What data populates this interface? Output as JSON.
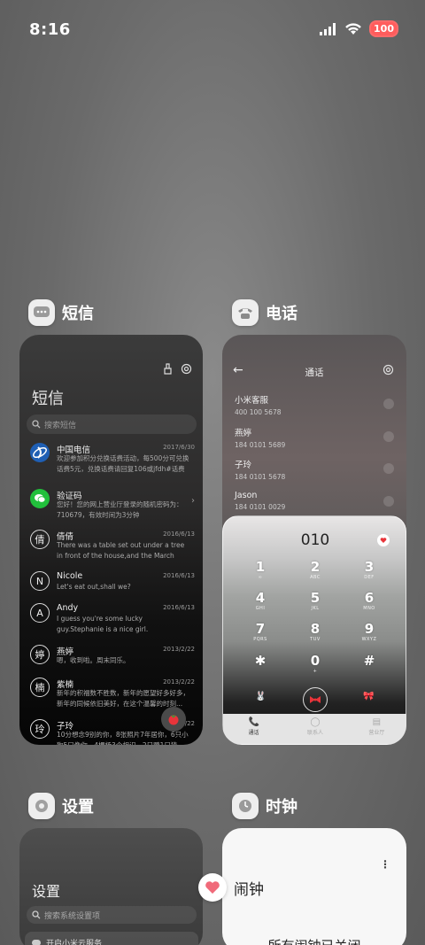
{
  "status_bar": {
    "time": "8:16",
    "battery": "100"
  },
  "apps": {
    "sms": {
      "name": "短信",
      "title": "短信",
      "search_placeholder": "搜索短信",
      "messages": [
        {
          "avatar": "",
          "name": "中国电信",
          "date": "2017/6/30",
          "text": "欢迎参加积分兑换话费活动，每500分可兑换话费5元，兑换话费请回复106或jfdh#话费"
        },
        {
          "avatar": "",
          "name": "验证码",
          "date": "",
          "text": "您好！您的网上营业厅登录的随机密码为：710679，有效时间为3分钟"
        },
        {
          "avatar": "倩",
          "name": "倩倩",
          "date": "2016/6/13",
          "text": "There was a table set out under a tree in front of the house,and the March Hare an..."
        },
        {
          "avatar": "N",
          "name": "Nicole",
          "date": "2016/6/13",
          "text": "Let's eat out,shall we?"
        },
        {
          "avatar": "A",
          "name": "Andy",
          "date": "2016/6/13",
          "text": "I guess you're some lucky guy.Stephanie is a nice girl."
        },
        {
          "avatar": "婷",
          "name": "燕婷",
          "date": "2013/2/22",
          "text": "嗯，收到啦。周末同乐。"
        },
        {
          "avatar": "楠",
          "name": "紫楠",
          "date": "2013/2/22",
          "text": "新年的积福数不胜数，新年的愿望好多好多，新年的同候依旧美好，在这个温馨的时刻..."
        },
        {
          "avatar": "玲",
          "name": "子玲",
          "date": "2013/2/22",
          "text": "10分想念9别的你，8张照片7年居你，6只小狗5只像你，4棵杨3个相识，2只鹦1只猜"
        }
      ]
    },
    "phone": {
      "name": "电话",
      "title": "通话",
      "calls": [
        {
          "name": "小米客服",
          "number": "400 100 5678"
        },
        {
          "name": "燕婷",
          "number": "184 0101 5689"
        },
        {
          "name": "子玲",
          "number": "184 0101 5678"
        },
        {
          "name": "Jason",
          "number": "184 0101 0029"
        }
      ],
      "dial_number": "010",
      "keys": [
        {
          "d": "1",
          "l": "∞"
        },
        {
          "d": "2",
          "l": "ABC"
        },
        {
          "d": "3",
          "l": "DEF"
        },
        {
          "d": "4",
          "l": "GHI"
        },
        {
          "d": "5",
          "l": "JKL"
        },
        {
          "d": "6",
          "l": "MNO"
        },
        {
          "d": "7",
          "l": "PQRS"
        },
        {
          "d": "8",
          "l": "TUV"
        },
        {
          "d": "9",
          "l": "WXYZ"
        },
        {
          "d": "✱",
          "l": ""
        },
        {
          "d": "0",
          "l": "+"
        },
        {
          "d": "#",
          "l": ""
        }
      ],
      "tabs": [
        {
          "label": "通话",
          "icon": "phone-icon"
        },
        {
          "label": "联系人",
          "icon": "contacts-icon"
        },
        {
          "label": "营业厅",
          "icon": "store-icon"
        }
      ]
    },
    "settings": {
      "name": "设置",
      "title": "设置",
      "search_placeholder": "搜索系统设置项",
      "first_item": "开启小米云服务"
    },
    "clock": {
      "name": "时钟",
      "title": "闹钟",
      "empty_text": "所有闹钟已关闭"
    }
  },
  "colors": {
    "accent_red": "#e8343a",
    "battery": "#ff5c5c"
  }
}
